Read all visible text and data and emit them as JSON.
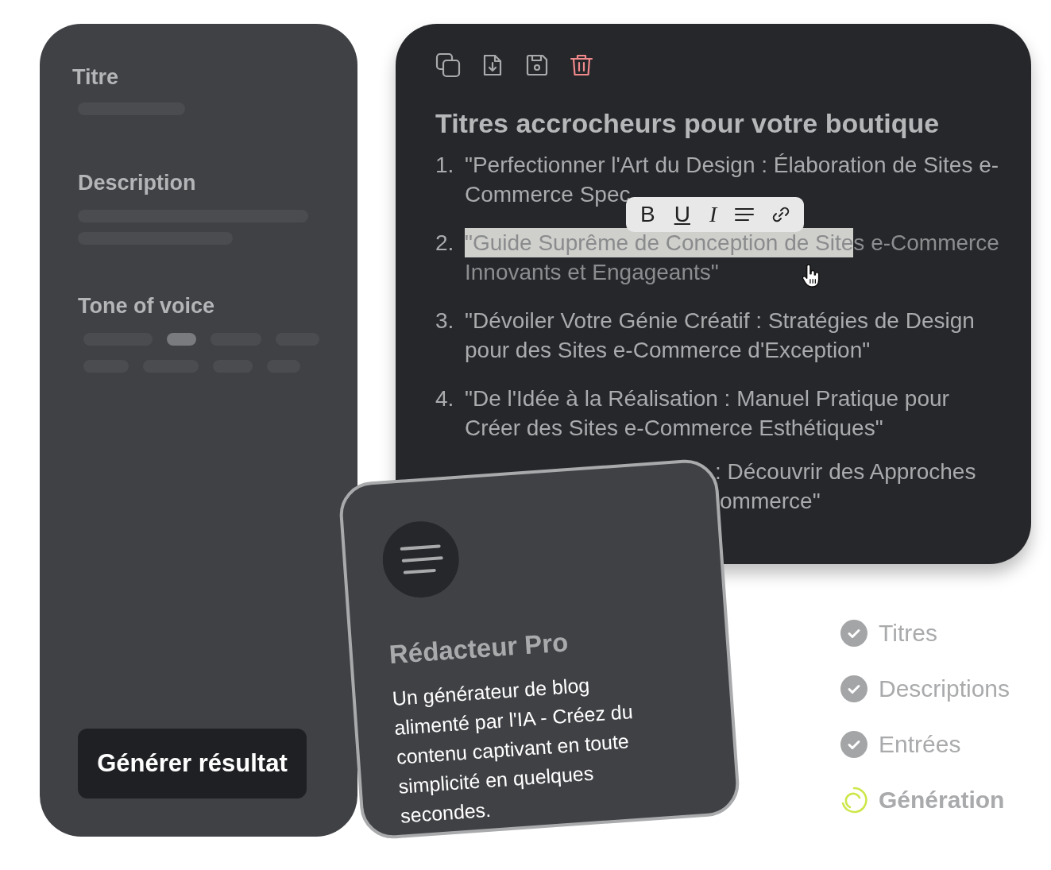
{
  "form": {
    "fields": [
      {
        "label": "Titre",
        "kind": "line"
      },
      {
        "label": "Description",
        "kind": "lines"
      },
      {
        "label": "Tone of voice",
        "kind": "chips"
      }
    ],
    "tone_chips": [
      {
        "selected": false
      },
      {
        "selected": true
      },
      {
        "selected": false
      },
      {
        "selected": false
      },
      {
        "selected": false
      },
      {
        "selected": false
      },
      {
        "selected": false
      },
      {
        "selected": false
      }
    ],
    "button": "Générer résultat"
  },
  "editor": {
    "toolbar": [
      {
        "kind": "copy"
      },
      {
        "kind": "download"
      },
      {
        "kind": "save"
      },
      {
        "kind": "delete"
      }
    ],
    "title": "Titres accrocheurs pour votre boutique",
    "items": [
      {
        "number": "1.",
        "lines": [
          [
            {
              "text": "\"Perfectionner l'Art du Design : Élaboration de Sites e-Commerce Spec",
              "selected": false
            }
          ]
        ]
      },
      {
        "number": "2.",
        "lines": [
          [
            {
              "text": "\"Guide Suprême de Conception de Site",
              "selected": true
            },
            {
              "text": "s e-Commerce",
              "selected": false
            }
          ],
          [
            {
              "text": "Innovants et Engageants\"",
              "selected": false
            }
          ]
        ]
      },
      {
        "number": "3.",
        "lines": [
          [
            {
              "text": "\"Dévoiler Votre Génie Créatif : Stratégies de Design pour des Sites e-Commerce d'Exception\"",
              "selected": false
            }
          ]
        ]
      },
      {
        "number": "4.",
        "lines": [
          [
            {
              "text": "\"De l'Idée à la Réalisation : Manuel Pratique pour Créer des Sites e-Commerce Esthétiques\"",
              "selected": false
            }
          ]
        ]
      }
    ],
    "partial_item": {
      "lines": [
        ": Découvrir des Approches",
        "ommerce\""
      ]
    },
    "format_bar": [
      {
        "kind": "bold",
        "label": "B"
      },
      {
        "kind": "underline",
        "label": "U"
      },
      {
        "kind": "italic",
        "label": "I"
      },
      {
        "kind": "align"
      },
      {
        "kind": "link"
      }
    ]
  },
  "card": {
    "title": "Rédacteur Pro",
    "description": "Un générateur de blog alimenté par l'IA - Créez du contenu captivant en toute simplicité en quelques secondes."
  },
  "steps": [
    {
      "label": "Titres",
      "done": true
    },
    {
      "label": "Descriptions",
      "done": true
    },
    {
      "label": "Entrées",
      "done": true
    },
    {
      "label": "Génération",
      "done": false
    }
  ]
}
